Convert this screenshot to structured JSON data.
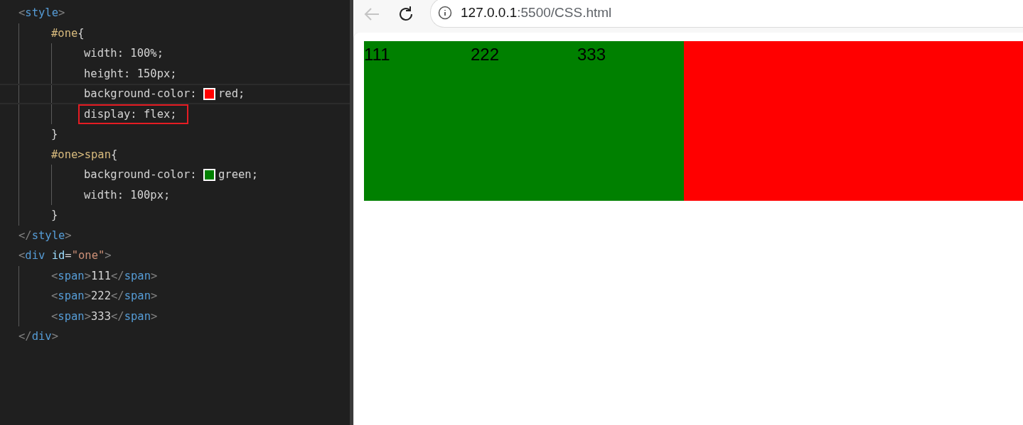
{
  "editor": {
    "lines": [
      {
        "tokens": [
          {
            "kind": "punct",
            "text": "<"
          },
          {
            "kind": "tag",
            "text": "style"
          },
          {
            "kind": "punct",
            "text": ">"
          }
        ],
        "children": [
          {
            "tokens": [
              {
                "kind": "selector",
                "text": "#one"
              },
              {
                "kind": "text",
                "text": "{"
              }
            ],
            "children": [
              {
                "tokens": [
                  {
                    "kind": "property",
                    "text": "width: 100%;"
                  }
                ]
              },
              {
                "tokens": [
                  {
                    "kind": "property",
                    "text": "height: 150px;"
                  }
                ]
              },
              {
                "current": true,
                "tokens": [
                  {
                    "kind": "property",
                    "text": "background-color: "
                  },
                  {
                    "kind": "swatch",
                    "color": "#ff0000"
                  },
                  {
                    "kind": "property",
                    "text": "red;"
                  }
                ]
              },
              {
                "boxed": true,
                "tokens": [
                  {
                    "kind": "property",
                    "text": "display: flex;"
                  }
                ]
              }
            ]
          },
          {
            "tokens": [
              {
                "kind": "text",
                "text": "}"
              }
            ]
          },
          {
            "tokens": [
              {
                "kind": "selector",
                "text": "#one>span"
              },
              {
                "kind": "text",
                "text": "{"
              }
            ],
            "children": [
              {
                "tokens": [
                  {
                    "kind": "property",
                    "text": "background-color: "
                  },
                  {
                    "kind": "swatch",
                    "color": "#008000"
                  },
                  {
                    "kind": "property",
                    "text": "green;"
                  }
                ]
              },
              {
                "tokens": [
                  {
                    "kind": "property",
                    "text": "width: 100px;"
                  }
                ]
              }
            ]
          },
          {
            "tokens": [
              {
                "kind": "text",
                "text": "}"
              }
            ]
          }
        ]
      },
      {
        "tokens": [
          {
            "kind": "punct",
            "text": "</"
          },
          {
            "kind": "tag",
            "text": "style"
          },
          {
            "kind": "punct",
            "text": ">"
          }
        ]
      },
      {
        "tokens": [
          {
            "kind": "punct",
            "text": "<"
          },
          {
            "kind": "tag",
            "text": "div"
          },
          {
            "kind": "attr",
            "text": " id"
          },
          {
            "kind": "text",
            "text": "="
          },
          {
            "kind": "string",
            "text": "\"one\""
          },
          {
            "kind": "punct",
            "text": ">"
          }
        ],
        "children": [
          {
            "tokens": [
              {
                "kind": "punct",
                "text": "<"
              },
              {
                "kind": "tag",
                "text": "span"
              },
              {
                "kind": "punct",
                "text": ">"
              },
              {
                "kind": "text",
                "text": "111"
              },
              {
                "kind": "punct",
                "text": "</"
              },
              {
                "kind": "tag",
                "text": "span"
              },
              {
                "kind": "punct",
                "text": ">"
              }
            ]
          },
          {
            "tokens": [
              {
                "kind": "punct",
                "text": "<"
              },
              {
                "kind": "tag",
                "text": "span"
              },
              {
                "kind": "punct",
                "text": ">"
              },
              {
                "kind": "text",
                "text": "222"
              },
              {
                "kind": "punct",
                "text": "</"
              },
              {
                "kind": "tag",
                "text": "span"
              },
              {
                "kind": "punct",
                "text": ">"
              }
            ]
          },
          {
            "tokens": [
              {
                "kind": "punct",
                "text": "<"
              },
              {
                "kind": "tag",
                "text": "span"
              },
              {
                "kind": "punct",
                "text": ">"
              },
              {
                "kind": "text",
                "text": "333"
              },
              {
                "kind": "punct",
                "text": "</"
              },
              {
                "kind": "tag",
                "text": "span"
              },
              {
                "kind": "punct",
                "text": ">"
              }
            ]
          }
        ]
      },
      {
        "tokens": [
          {
            "kind": "punct",
            "text": "</"
          },
          {
            "kind": "tag",
            "text": "div"
          },
          {
            "kind": "punct",
            "text": ">"
          }
        ]
      }
    ]
  },
  "browser": {
    "back": {
      "disabled": true
    },
    "url_host": "127.0.0.1",
    "url_path": ":5500/CSS.html",
    "page": {
      "spans": [
        {
          "label": "111"
        },
        {
          "label": "222"
        },
        {
          "label": "333"
        }
      ]
    }
  }
}
